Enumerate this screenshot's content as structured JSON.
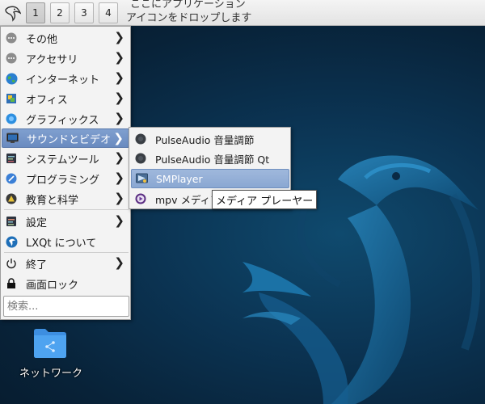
{
  "panel": {
    "workspaces": [
      "1",
      "2",
      "3",
      "4"
    ],
    "active_workspace": "1",
    "quicklaunch_hint_line1": "ここにアプリケーション",
    "quicklaunch_hint_line2": "アイコンをドロップします"
  },
  "main_menu": {
    "items": [
      {
        "label": "その他",
        "icon": "more-icon"
      },
      {
        "label": "アクセサリ",
        "icon": "accessories-icon"
      },
      {
        "label": "インターネット",
        "icon": "globe-icon"
      },
      {
        "label": "オフィス",
        "icon": "office-icon"
      },
      {
        "label": "グラフィックス",
        "icon": "graphics-icon"
      },
      {
        "label": "サウンドとビデオ",
        "icon": "multimedia-icon"
      },
      {
        "label": "システムツール",
        "icon": "system-tools-icon"
      },
      {
        "label": "プログラミング",
        "icon": "programming-icon"
      },
      {
        "label": "教育と科学",
        "icon": "science-icon"
      },
      {
        "label": "設定",
        "icon": "settings-icon"
      },
      {
        "label": "LXQt について",
        "icon": "lxqt-icon"
      },
      {
        "label": "終了",
        "icon": "power-icon"
      },
      {
        "label": "画面ロック",
        "icon": "lock-icon"
      }
    ],
    "selected": "サウンドとビデオ",
    "search_placeholder": "検索..."
  },
  "sub_menu": {
    "items": [
      {
        "label": "PulseAudio 音量調節",
        "icon": "pulseaudio-icon"
      },
      {
        "label": "PulseAudio 音量調節 Qt",
        "icon": "pulseaudio-icon"
      },
      {
        "label": "SMPlayer",
        "icon": "smplayer-icon"
      },
      {
        "label": "mpv メディア プレーヤー",
        "icon": "mpv-icon"
      }
    ],
    "selected": "SMPlayer"
  },
  "tooltip": {
    "text": "メディア プレーヤー"
  },
  "desktop": {
    "icons": [
      {
        "label": "ネットワーク",
        "icon": "network-folder-icon"
      }
    ]
  },
  "colors": {
    "menu_highlight": "#6a8bc0",
    "submenu_highlight": "#8aa7d2",
    "desktop_background": "#0b3352",
    "wallpaper_bird": "#1a6f9e"
  }
}
